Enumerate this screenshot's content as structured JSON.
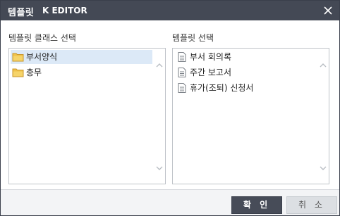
{
  "dialog": {
    "title": "템플릿",
    "subtitle": "K EDITOR",
    "close_icon": "close-icon"
  },
  "left_panel": {
    "label": "템플릿 클래스 선택",
    "items": [
      {
        "label": "부서양식",
        "icon": "folder-icon",
        "selected": true
      },
      {
        "label": "총무",
        "icon": "folder-icon",
        "selected": false
      }
    ]
  },
  "right_panel": {
    "label": "템플릿 선택",
    "items": [
      {
        "label": "부서 회의록",
        "icon": "document-icon"
      },
      {
        "label": "주간 보고서",
        "icon": "document-icon"
      },
      {
        "label": "휴가(조퇴) 신청서",
        "icon": "document-icon"
      }
    ]
  },
  "buttons": {
    "ok": "확 인",
    "cancel": "취 소"
  },
  "colors": {
    "titlebar": "#444955",
    "selection": "#dce9f7",
    "folder": "#f0c24b",
    "ok_button": "#474c58"
  }
}
